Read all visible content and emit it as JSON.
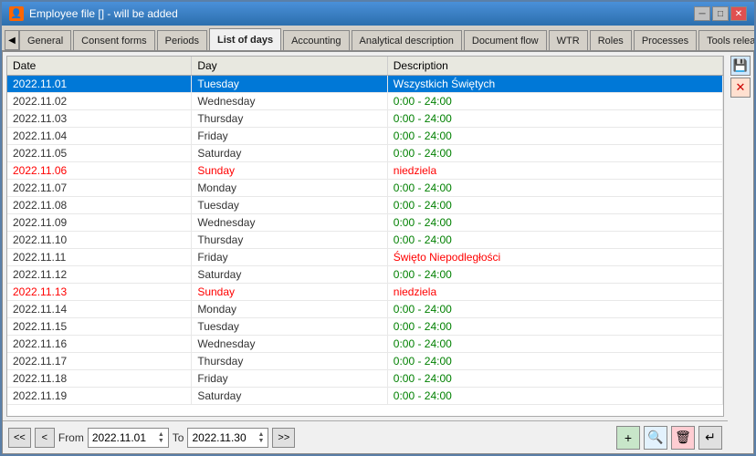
{
  "window": {
    "title": "Employee file [] - will be added",
    "icon": "👤"
  },
  "titlebar_controls": {
    "minimize": "─",
    "maximize": "□",
    "close": "✕"
  },
  "tabs": [
    {
      "id": "general",
      "label": "General",
      "active": false
    },
    {
      "id": "consent",
      "label": "Consent forms",
      "active": false
    },
    {
      "id": "periods",
      "label": "Periods",
      "active": false
    },
    {
      "id": "listofdays",
      "label": "List of days",
      "active": true
    },
    {
      "id": "accounting",
      "label": "Accounting",
      "active": false
    },
    {
      "id": "analytical",
      "label": "Analytical description",
      "active": false
    },
    {
      "id": "docflow",
      "label": "Document flow",
      "active": false
    },
    {
      "id": "wtr",
      "label": "WTR",
      "active": false
    },
    {
      "id": "roles",
      "label": "Roles",
      "active": false
    },
    {
      "id": "processes",
      "label": "Processes",
      "active": false
    },
    {
      "id": "tools",
      "label": "Tools released",
      "active": false
    }
  ],
  "table": {
    "columns": [
      "Date",
      "Day",
      "Description"
    ],
    "rows": [
      {
        "date": "2022.11.01",
        "day": "Tuesday",
        "desc": "Wszystkich Świętych",
        "selected": true,
        "sunday": false,
        "holiday": true
      },
      {
        "date": "2022.11.02",
        "day": "Wednesday",
        "desc": "0:00 - 24:00",
        "selected": false,
        "sunday": false,
        "holiday": false
      },
      {
        "date": "2022.11.03",
        "day": "Thursday",
        "desc": "0:00 - 24:00",
        "selected": false,
        "sunday": false,
        "holiday": false
      },
      {
        "date": "2022.11.04",
        "day": "Friday",
        "desc": "0:00 - 24:00",
        "selected": false,
        "sunday": false,
        "holiday": false
      },
      {
        "date": "2022.11.05",
        "day": "Saturday",
        "desc": "0:00 - 24:00",
        "selected": false,
        "sunday": false,
        "holiday": false
      },
      {
        "date": "2022.11.06",
        "day": "Sunday",
        "desc": "niedziela",
        "selected": false,
        "sunday": true,
        "holiday": true
      },
      {
        "date": "2022.11.07",
        "day": "Monday",
        "desc": "0:00 - 24:00",
        "selected": false,
        "sunday": false,
        "holiday": false
      },
      {
        "date": "2022.11.08",
        "day": "Tuesday",
        "desc": "0:00 - 24:00",
        "selected": false,
        "sunday": false,
        "holiday": false
      },
      {
        "date": "2022.11.09",
        "day": "Wednesday",
        "desc": "0:00 - 24:00",
        "selected": false,
        "sunday": false,
        "holiday": false
      },
      {
        "date": "2022.11.10",
        "day": "Thursday",
        "desc": "0:00 - 24:00",
        "selected": false,
        "sunday": false,
        "holiday": false
      },
      {
        "date": "2022.11.11",
        "day": "Friday",
        "desc": "Święto Niepodległości",
        "selected": false,
        "sunday": false,
        "holiday": true
      },
      {
        "date": "2022.11.12",
        "day": "Saturday",
        "desc": "0:00 - 24:00",
        "selected": false,
        "sunday": false,
        "holiday": false
      },
      {
        "date": "2022.11.13",
        "day": "Sunday",
        "desc": "niedziela",
        "selected": false,
        "sunday": true,
        "holiday": true
      },
      {
        "date": "2022.11.14",
        "day": "Monday",
        "desc": "0:00 - 24:00",
        "selected": false,
        "sunday": false,
        "holiday": false
      },
      {
        "date": "2022.11.15",
        "day": "Tuesday",
        "desc": "0:00 - 24:00",
        "selected": false,
        "sunday": false,
        "holiday": false
      },
      {
        "date": "2022.11.16",
        "day": "Wednesday",
        "desc": "0:00 - 24:00",
        "selected": false,
        "sunday": false,
        "holiday": false
      },
      {
        "date": "2022.11.17",
        "day": "Thursday",
        "desc": "0:00 - 24:00",
        "selected": false,
        "sunday": false,
        "holiday": false
      },
      {
        "date": "2022.11.18",
        "day": "Friday",
        "desc": "0:00 - 24:00",
        "selected": false,
        "sunday": false,
        "holiday": false
      },
      {
        "date": "2022.11.19",
        "day": "Saturday",
        "desc": "0:00 - 24:00",
        "selected": false,
        "sunday": false,
        "holiday": false
      }
    ]
  },
  "right_buttons": {
    "save": "💾",
    "delete": "✕"
  },
  "bottom": {
    "from_label": "From",
    "to_label": "To",
    "from_value": "2022.11.01",
    "to_value": "2022.11.30",
    "prev_prev": "<<",
    "prev": "<",
    "next": ">",
    "next_next": ">>",
    "add_icon": "+",
    "search_icon": "🔍",
    "delete_icon": "🗑",
    "arrow_icon": "↵"
  }
}
